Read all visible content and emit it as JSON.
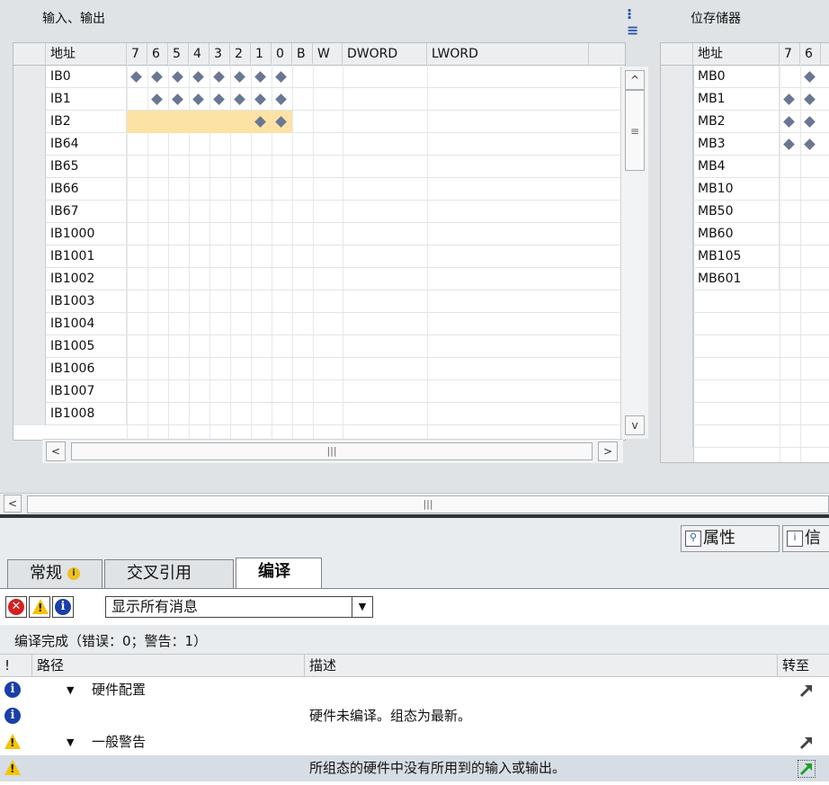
{
  "io_panel": {
    "title": "输入、输出",
    "columns": [
      "地址",
      "7",
      "6",
      "5",
      "4",
      "3",
      "2",
      "1",
      "0",
      "B",
      "W",
      "DWORD",
      "LWORD"
    ],
    "rows": [
      {
        "addr": "IB0",
        "bits": [
          1,
          1,
          1,
          1,
          1,
          1,
          1,
          1
        ],
        "highlight": false
      },
      {
        "addr": "IB1",
        "bits": [
          0,
          1,
          1,
          1,
          1,
          1,
          1,
          1
        ],
        "highlight": false
      },
      {
        "addr": "IB2",
        "bits": [
          0,
          0,
          0,
          0,
          0,
          0,
          1,
          1
        ],
        "highlight": true
      },
      {
        "addr": "IB64",
        "bits": [
          0,
          0,
          0,
          0,
          0,
          0,
          0,
          0
        ],
        "highlight": false
      },
      {
        "addr": "IB65",
        "bits": [
          0,
          0,
          0,
          0,
          0,
          0,
          0,
          0
        ],
        "highlight": false
      },
      {
        "addr": "IB66",
        "bits": [
          0,
          0,
          0,
          0,
          0,
          0,
          0,
          0
        ],
        "highlight": false
      },
      {
        "addr": "IB67",
        "bits": [
          0,
          0,
          0,
          0,
          0,
          0,
          0,
          0
        ],
        "highlight": false
      },
      {
        "addr": "IB1000",
        "bits": [
          0,
          0,
          0,
          0,
          0,
          0,
          0,
          0
        ],
        "highlight": false
      },
      {
        "addr": "IB1001",
        "bits": [
          0,
          0,
          0,
          0,
          0,
          0,
          0,
          0
        ],
        "highlight": false
      },
      {
        "addr": "IB1002",
        "bits": [
          0,
          0,
          0,
          0,
          0,
          0,
          0,
          0
        ],
        "highlight": false
      },
      {
        "addr": "IB1003",
        "bits": [
          0,
          0,
          0,
          0,
          0,
          0,
          0,
          0
        ],
        "highlight": false
      },
      {
        "addr": "IB1004",
        "bits": [
          0,
          0,
          0,
          0,
          0,
          0,
          0,
          0
        ],
        "highlight": false
      },
      {
        "addr": "IB1005",
        "bits": [
          0,
          0,
          0,
          0,
          0,
          0,
          0,
          0
        ],
        "highlight": false
      },
      {
        "addr": "IB1006",
        "bits": [
          0,
          0,
          0,
          0,
          0,
          0,
          0,
          0
        ],
        "highlight": false
      },
      {
        "addr": "IB1007",
        "bits": [
          0,
          0,
          0,
          0,
          0,
          0,
          0,
          0
        ],
        "highlight": false
      },
      {
        "addr": "IB1008",
        "bits": [
          0,
          0,
          0,
          0,
          0,
          0,
          0,
          0
        ],
        "highlight": false
      }
    ]
  },
  "mem_panel": {
    "title": "位存储器",
    "columns": [
      "地址",
      "7",
      "6"
    ],
    "rows": [
      {
        "addr": "MB0",
        "bits": [
          0,
          1
        ]
      },
      {
        "addr": "MB1",
        "bits": [
          1,
          1
        ]
      },
      {
        "addr": "MB2",
        "bits": [
          1,
          1
        ]
      },
      {
        "addr": "MB3",
        "bits": [
          1,
          1
        ]
      },
      {
        "addr": "MB4",
        "bits": [
          0,
          0
        ]
      },
      {
        "addr": "MB10",
        "bits": [
          0,
          0
        ]
      },
      {
        "addr": "MB50",
        "bits": [
          0,
          0
        ]
      },
      {
        "addr": "MB60",
        "bits": [
          0,
          0
        ]
      },
      {
        "addr": "MB105",
        "bits": [
          0,
          0
        ]
      },
      {
        "addr": "MB601",
        "bits": [
          0,
          0
        ]
      }
    ]
  },
  "scroll": {
    "up": "^",
    "down": "v",
    "left": "<",
    "right": ">",
    "grip": "|||",
    "grip_v": "≡"
  },
  "inspector": {
    "top_tabs": [
      {
        "label": "属性",
        "icon": "magnifier-icon"
      },
      {
        "label": "信",
        "icon": "info-icon"
      }
    ],
    "tabs": [
      {
        "label": "常规",
        "badge": "i"
      },
      {
        "label": "交叉引用"
      },
      {
        "label": "编译",
        "active": true
      }
    ],
    "filter": {
      "error_glyph": "✕",
      "warning_glyph": "!",
      "info_glyph": "i",
      "selected": "显示所有消息"
    },
    "status": "编译完成（错误：0；警告：1）",
    "columns": {
      "flag": "!",
      "path": "路径",
      "desc": "描述",
      "goto": "转至"
    },
    "messages": [
      {
        "type": "info",
        "path": "硬件配置",
        "desc": "",
        "expand": "▼",
        "goto": true,
        "selected": false
      },
      {
        "type": "info",
        "path": "",
        "desc": "硬件未编译。组态为最新。",
        "expand": "",
        "goto": false,
        "selected": false
      },
      {
        "type": "warning",
        "path": "一般警告",
        "desc": "",
        "expand": "▼",
        "goto": true,
        "selected": false
      },
      {
        "type": "warning",
        "path": "",
        "desc": "所组态的硬件中没有所用到的输入或输出。",
        "expand": "",
        "goto": true,
        "selected": true
      }
    ]
  },
  "colors": {
    "diamond": "#6a7792",
    "highlight": "#fde2a6",
    "selected_row": "#d6dde4",
    "goto_active": "#1fa02a",
    "goto": "#444444"
  }
}
